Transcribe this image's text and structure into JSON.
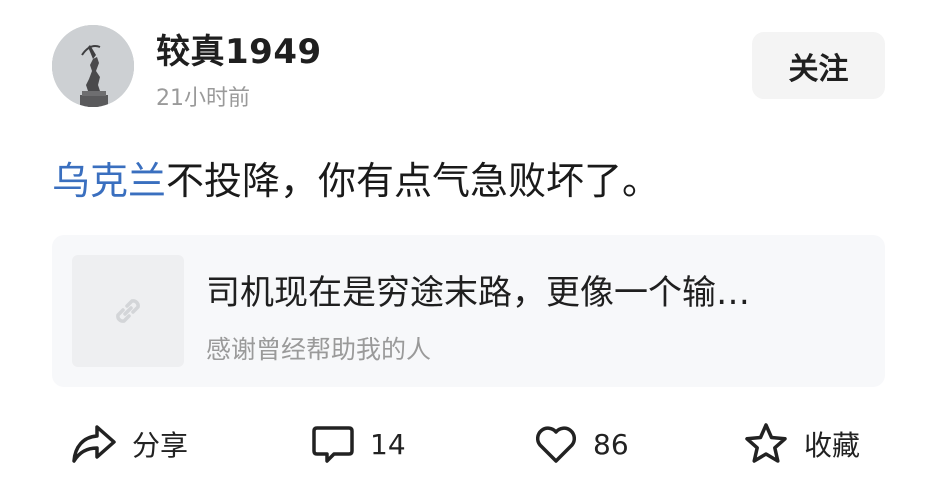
{
  "post": {
    "author": "较真1949",
    "time": "21小时前",
    "follow_label": "关注",
    "text_topic": "乌克兰",
    "text_rest": "不投降，你有点气急败坏了。"
  },
  "link_card": {
    "title": "司机现在是穷途末路，更像一个输…",
    "subtitle": "感谢曾经帮助我的人",
    "thumb_icon": "link-icon"
  },
  "actions": {
    "share_label": "分享",
    "comment_count": "14",
    "like_count": "86",
    "favorite_label": "收藏"
  },
  "icons": {
    "share": "share-arrow-icon",
    "comment": "comment-bubble-icon",
    "like": "heart-icon",
    "favorite": "star-icon"
  },
  "colors": {
    "topic_link": "#3a6fbf",
    "follow_bg": "#f4f4f4",
    "card_bg": "#f7f8fa",
    "meta_text": "#9a9a9a"
  }
}
